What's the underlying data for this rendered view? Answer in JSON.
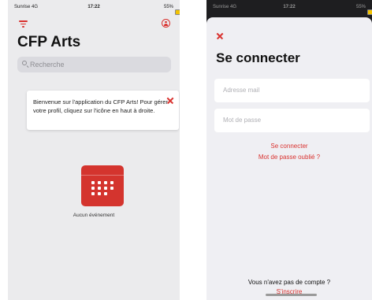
{
  "status_bar": {
    "carrier": "Sunrise 4G",
    "time": "17:22",
    "battery": "55%",
    "battery_level": 0.55
  },
  "left_screen": {
    "title": "CFP Arts",
    "search_placeholder": "Recherche",
    "welcome_message": "Bienvenue sur l'application du CFP Arts! Pour gérer votre profil, cliquez sur l'icône en haut à droite.",
    "empty_state": "Aucun événement"
  },
  "right_screen": {
    "title": "Se connecter",
    "email_placeholder": "Adresse mail",
    "password_placeholder": "Mot de passe",
    "login_link": "Se connecter",
    "forgot_link": "Mot de passe oublié ?",
    "no_account_text": "Vous n'avez pas de compte ?",
    "signup_link": "S'inscrire"
  },
  "colors": {
    "accent": "#d9322f",
    "background": "#ebebed",
    "card": "#ffffff"
  }
}
